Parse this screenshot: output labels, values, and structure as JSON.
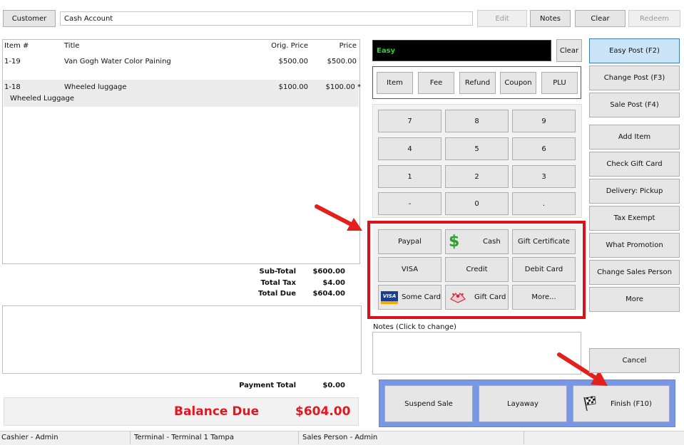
{
  "top_bar": {
    "customer_label": "Customer",
    "account_value": "Cash Account",
    "edit_label": "Edit",
    "notes_label": "Notes",
    "clear_label": "Clear",
    "redeem_label": "Redeem"
  },
  "items_table": {
    "columns": [
      "Item #",
      "Title",
      "Orig. Price",
      "Price"
    ],
    "rows": [
      {
        "item": "1-19",
        "title": "Van Gogh Water Color Paining",
        "orig_price": "$500.00",
        "price": "$500.00",
        "note": ""
      },
      {
        "item": "1-18",
        "title": "Wheeled luggage",
        "orig_price": "$100.00",
        "price": "$100.00 *",
        "note": "Wheeled Luggage"
      }
    ]
  },
  "totals": {
    "subtotal_label": "Sub-Total",
    "subtotal_value": "$600.00",
    "tax_label": "Total Tax",
    "tax_value": "$4.00",
    "due_label": "Total Due",
    "due_value": "$604.00",
    "payment_total_label": "Payment Total",
    "payment_total_value": "$0.00",
    "balance_label": "Balance Due",
    "balance_value": "$604.00"
  },
  "easy_input": {
    "display": "Easy",
    "clear_label": "Clear"
  },
  "line_types": [
    "Item",
    "Fee",
    "Refund",
    "Coupon",
    "PLU"
  ],
  "keypad": [
    "7",
    "8",
    "9",
    "4",
    "5",
    "6",
    "1",
    "2",
    "3",
    "-",
    "0",
    "."
  ],
  "payments": {
    "paypal": "Paypal",
    "cash": "Cash",
    "gift_certificate": "Gift Certificate",
    "visa": "VISA",
    "credit": "Credit",
    "debit_card": "Debit Card",
    "some_card": "Some Card",
    "gift_card": "Gift Card",
    "more": "More...",
    "visa_logo_text": "VISA"
  },
  "notes": {
    "label": "Notes (Click to change)"
  },
  "actions": {
    "suspend": "Suspend Sale",
    "layaway": "Layaway",
    "finish": "Finish (F10)"
  },
  "right_column": {
    "easy_post": "Easy Post (F2)",
    "change_post": "Change Post (F3)",
    "sale_post": "Sale Post (F4)",
    "add_item": "Add Item",
    "check_gift_card": "Check Gift Card",
    "delivery": "Delivery: Pickup",
    "tax_exempt": "Tax Exempt",
    "what_promotion": "What Promotion",
    "change_sales_person": "Change Sales Person",
    "more": "More",
    "cancel": "Cancel"
  },
  "status_bar": {
    "cashier": "Cashier - Admin",
    "terminal": "Terminal - Terminal 1 Tampa",
    "sales_person": "Sales Person - Admin"
  },
  "colors": {
    "balance_red": "#e8141e",
    "highlight_red": "#d9111a",
    "easy_green": "#2bd62b",
    "action_blue": "#7a97e6",
    "easy_post_blue": "#cce4f7"
  }
}
